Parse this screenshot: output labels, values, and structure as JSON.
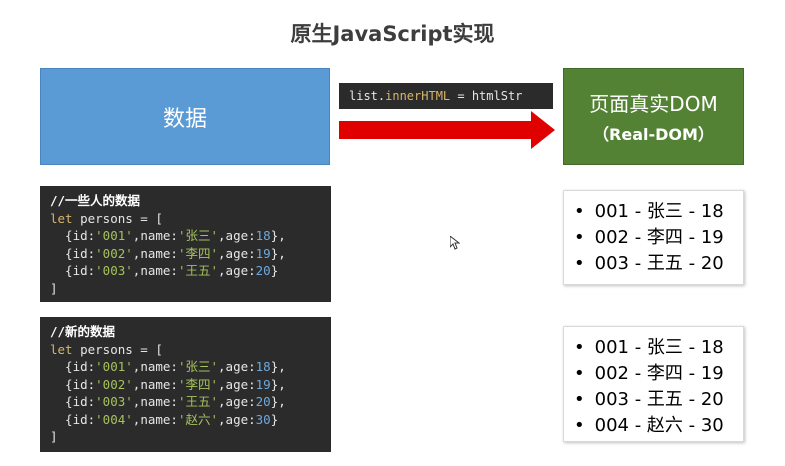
{
  "title": "原生JavaScript实现",
  "data_box": {
    "label": "数据"
  },
  "dom_box": {
    "line1": "页面真实DOM",
    "line2": "（Real-DOM）"
  },
  "code_label": {
    "prefix": "list.",
    "prop": "innerHTML",
    "suffix": " = htmlStr"
  },
  "arrow_color": "#e00000",
  "code_block_1": {
    "comment": "//一些人的数据",
    "keyword": "let",
    "decl": " persons = [",
    "rows": [
      {
        "a": "  {id:",
        "id": "'001'",
        "b": ",name:",
        "name": "'张三'",
        "c": ",age:",
        "age": "18",
        "d": "},"
      },
      {
        "a": "  {id:",
        "id": "'002'",
        "b": ",name:",
        "name": "'李四'",
        "c": ",age:",
        "age": "19",
        "d": "},"
      },
      {
        "a": "  {id:",
        "id": "'003'",
        "b": ",name:",
        "name": "'王五'",
        "c": ",age:",
        "age": "20",
        "d": "}"
      }
    ],
    "close": "]"
  },
  "code_block_2": {
    "comment": "//新的数据",
    "keyword": "let",
    "decl": " persons = [",
    "rows": [
      {
        "a": "  {id:",
        "id": "'001'",
        "b": ",name:",
        "name": "'张三'",
        "c": ",age:",
        "age": "18",
        "d": "},"
      },
      {
        "a": "  {id:",
        "id": "'002'",
        "b": ",name:",
        "name": "'李四'",
        "c": ",age:",
        "age": "19",
        "d": "},"
      },
      {
        "a": "  {id:",
        "id": "'003'",
        "b": ",name:",
        "name": "'王五'",
        "c": ",age:",
        "age": "20",
        "d": "},"
      },
      {
        "a": "  {id:",
        "id": "'004'",
        "b": ",name:",
        "name": "'赵六'",
        "c": ",age:",
        "age": "30",
        "d": "}"
      }
    ],
    "close": "]"
  },
  "list_1": [
    "001 - 张三 - 18",
    "002 - 李四 - 19",
    "003 - 王五 - 20"
  ],
  "list_2": [
    "001 - 张三 - 18",
    "002 - 李四 - 19",
    "003 - 王五 - 20",
    "004 - 赵六 - 30"
  ]
}
